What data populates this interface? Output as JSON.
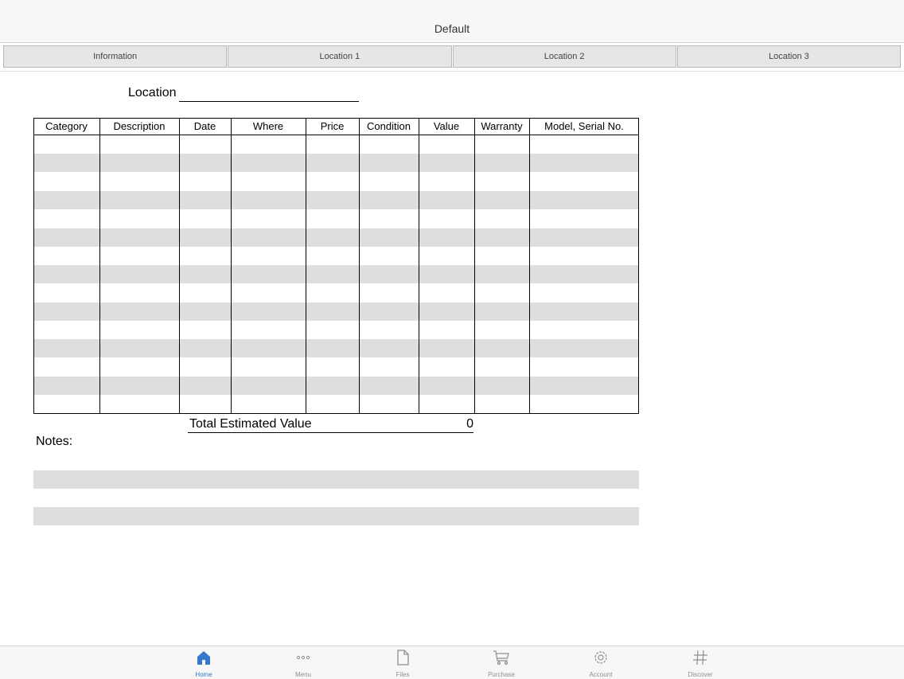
{
  "header": {
    "title": "Default"
  },
  "tabs": [
    "Information",
    "Location 1",
    "Location 2",
    "Location 3"
  ],
  "form": {
    "location_label": "Location",
    "columns": [
      "Category",
      "Description",
      "Date",
      "Where",
      "Price",
      "Condition",
      "Value",
      "Warranty",
      "Model, Serial No."
    ],
    "row_count": 15,
    "total_label": "Total Estimated Value",
    "total_value": "0",
    "notes_label": "Notes:"
  },
  "tabbar": {
    "items": [
      {
        "label": "Home",
        "icon": "home-icon",
        "active": true
      },
      {
        "label": "Menu",
        "icon": "more-icon",
        "active": false
      },
      {
        "label": "Files",
        "icon": "file-icon",
        "active": false
      },
      {
        "label": "Purchase",
        "icon": "cart-icon",
        "active": false
      },
      {
        "label": "Account",
        "icon": "gear-icon",
        "active": false
      },
      {
        "label": "Discover",
        "icon": "hashtag-icon",
        "active": false
      }
    ]
  },
  "colors": {
    "accent": "#3478d6",
    "band": "#dedee0",
    "inactive": "#8e8e93"
  }
}
